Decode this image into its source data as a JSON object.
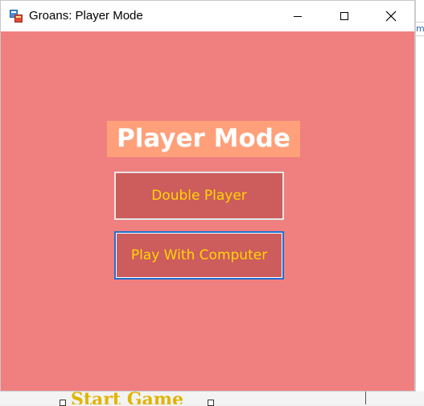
{
  "window": {
    "title": "Groans: Player Mode"
  },
  "title_controls": {
    "minimize_icon": "minimize-icon",
    "maximize_icon": "maximize-icon",
    "close_icon": "close-icon"
  },
  "main": {
    "heading": "Player Mode",
    "double_player_label": "Double Player",
    "play_computer_label": "Play With Computer"
  },
  "background": {
    "right_fragment": "m",
    "bottom_fragment": "Start Game"
  },
  "colors": {
    "window_bg": "#f08080",
    "heading_bg": "#ffa07a",
    "button_bg": "#cd5c5c",
    "button_text": "#ffd700",
    "focus_border": "#1f6fd1"
  }
}
